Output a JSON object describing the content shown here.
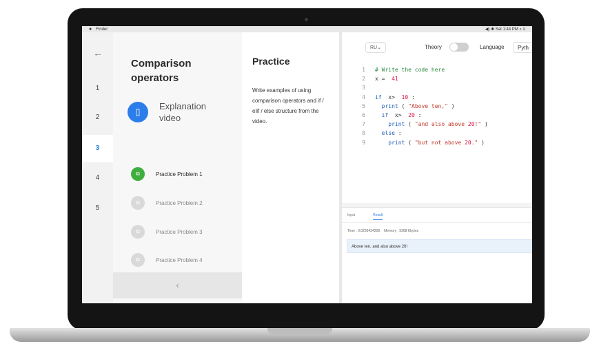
{
  "menubar": {
    "apple": "",
    "app_name": "Finder",
    "status": "◀) ✱ Sat 1:44 PM ⌕ ≡"
  },
  "rail": {
    "back_icon": "←",
    "steps": [
      "1",
      "2",
      "3",
      "4",
      "5"
    ],
    "active_step": 3
  },
  "lesson": {
    "title": "Comparison operators",
    "items": [
      {
        "label": "Explanation video",
        "state": "current",
        "icon": "document-icon",
        "glyph": "▯"
      },
      {
        "label": "Practice Problem 1",
        "state": "done",
        "icon": "code-icon",
        "glyph": "⧉"
      },
      {
        "label": "Practice Problem 2",
        "state": "locked",
        "icon": "code-icon",
        "glyph": "⧉"
      },
      {
        "label": "Practice Problem 3",
        "state": "locked",
        "icon": "code-icon",
        "glyph": "⧉"
      },
      {
        "label": "Practice Problem 4",
        "state": "locked",
        "icon": "code-icon",
        "glyph": "⧉"
      }
    ],
    "collapse_icon": "‹"
  },
  "practice": {
    "title": "Practice",
    "description": "Write examples of using comparison operators and if / elif / else structure from the video."
  },
  "editor": {
    "ui_language": "RU",
    "theory_label": "Theory",
    "theory_on": false,
    "language_label": "Language",
    "language_value": "Pyth",
    "lines": [
      {
        "n": "1",
        "code": "# Write the code here",
        "kind": "comment"
      },
      {
        "n": "2",
        "code": "x =  41",
        "kind": "code"
      },
      {
        "n": "3",
        "code": "",
        "kind": "code"
      },
      {
        "n": "4",
        "code": "if  x>  10 :",
        "kind": "code"
      },
      {
        "n": "5",
        "code": "  print ( \"Above ten,\" )",
        "kind": "code"
      },
      {
        "n": "6",
        "code": "  if  x>  20 :",
        "kind": "code"
      },
      {
        "n": "7",
        "code": "    print ( \"and also above 20!\" )",
        "kind": "code"
      },
      {
        "n": "8",
        "code": "  else :",
        "kind": "code"
      },
      {
        "n": "9",
        "code": "    print ( \"but not above 20.\" )",
        "kind": "code"
      }
    ]
  },
  "io": {
    "tabs": [
      "Input",
      "Result"
    ],
    "active_tab": "Result",
    "time": "Time : 0.0293434208",
    "memory": "Memory : 9368 Kbytes",
    "result_text": "Above ten, and also above 20!"
  },
  "colors": {
    "accent": "#2b7de9",
    "success": "#3eae3e",
    "comment": "#2b8a3e",
    "keyword": "#1f5fbf",
    "string": "#c0392b",
    "operator": "#d14"
  }
}
